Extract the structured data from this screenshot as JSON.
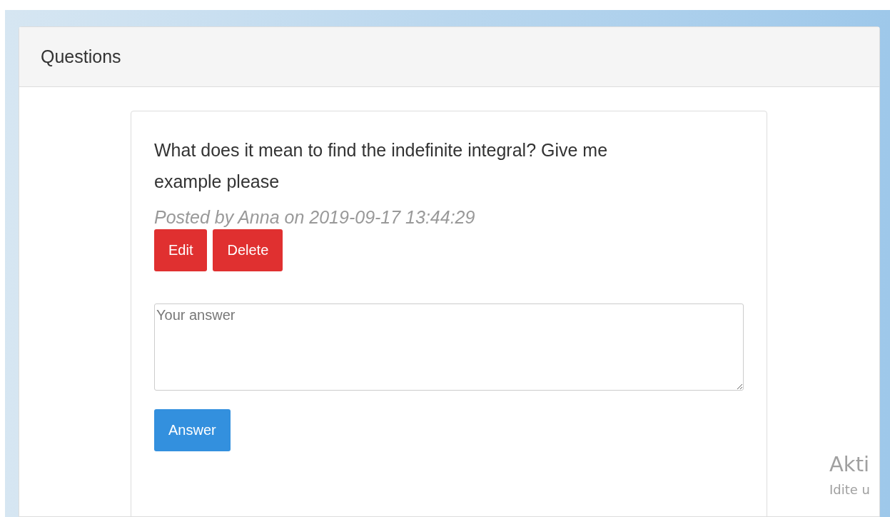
{
  "panel": {
    "title": "Questions"
  },
  "question": {
    "text": "What does it mean to find the indefinite integral? Give me example please",
    "meta": "Posted by Anna on 2019-09-17 13:44:29",
    "actions": [
      {
        "label": "Edit"
      },
      {
        "label": "Delete"
      }
    ]
  },
  "answer_form": {
    "placeholder": "Your answer",
    "submit": "Answer"
  },
  "activation_notice": [
    "Akti",
    "Idite u"
  ]
}
